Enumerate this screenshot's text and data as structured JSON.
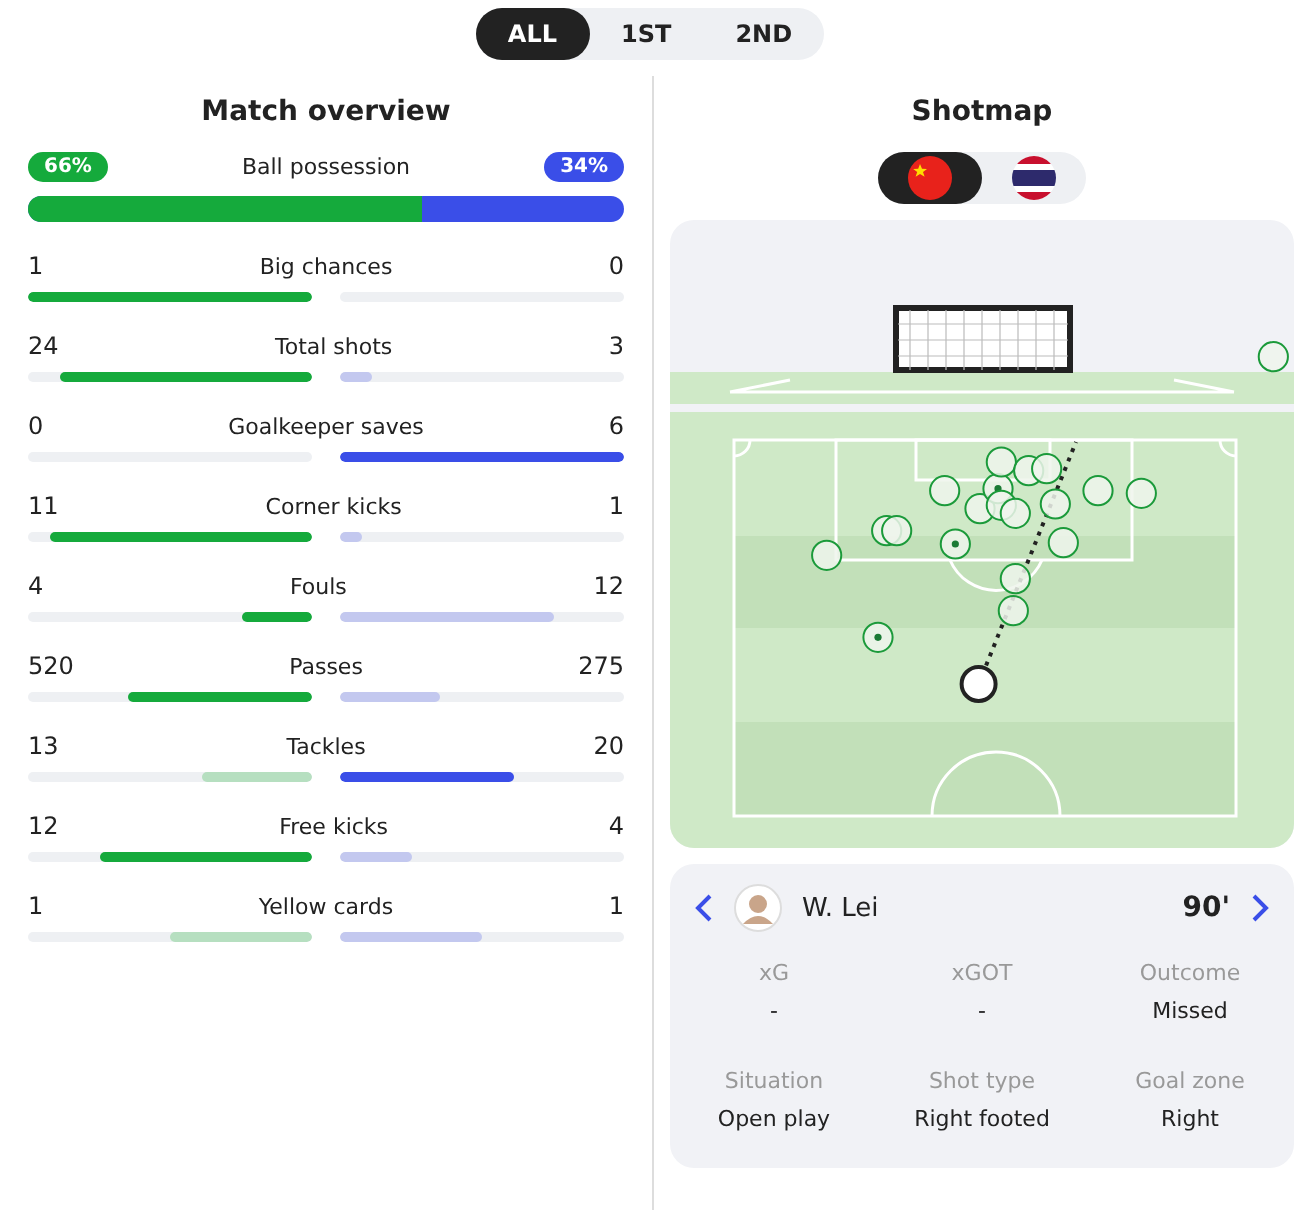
{
  "period_tabs": [
    {
      "label": "ALL",
      "selected": true
    },
    {
      "label": "1ST",
      "selected": false
    },
    {
      "label": "2ND",
      "selected": false
    }
  ],
  "overview": {
    "title": "Match overview",
    "possession": {
      "label": "Ball possession",
      "home": "66%",
      "away": "34%",
      "level": 0.66
    },
    "stats": [
      {
        "label": "Big chances",
        "home": {
          "value": "1",
          "level": 1,
          "leads": true
        },
        "away": {
          "value": "0",
          "level": 0
        }
      },
      {
        "label": "Total shots",
        "home": {
          "value": "24",
          "level": 0.89,
          "leads": true
        },
        "away": {
          "value": "3",
          "level": 0.11,
          "leads": false
        }
      },
      {
        "label": "Goalkeeper saves",
        "home": {
          "value": "0",
          "level": 0
        },
        "away": {
          "value": "6",
          "level": 1,
          "leads": true
        }
      },
      {
        "label": "Corner kicks",
        "home": {
          "value": "11",
          "level": 0.92,
          "leads": true
        },
        "away": {
          "value": "1",
          "level": 0.08,
          "leads": false
        }
      },
      {
        "label": "Fouls",
        "home": {
          "value": "4",
          "level": 0.25,
          "leads": true
        },
        "away": {
          "value": "12",
          "level": 0.75,
          "leads": false
        }
      },
      {
        "label": "Passes",
        "home": {
          "value": "520",
          "level": 0.65,
          "leads": true
        },
        "away": {
          "value": "275",
          "level": 0.35,
          "leads": false
        }
      },
      {
        "label": "Tackles",
        "home": {
          "value": "13",
          "level": 0.39,
          "leads": false
        },
        "away": {
          "value": "20",
          "level": 0.61,
          "leads": true
        }
      },
      {
        "label": "Free kicks",
        "home": {
          "value": "12",
          "level": 0.75,
          "leads": true
        },
        "away": {
          "value": "4",
          "level": 0.25,
          "leads": false
        }
      },
      {
        "label": "Yellow cards",
        "home": {
          "value": "1",
          "level": 0.5,
          "leads": false
        },
        "away": {
          "value": "1",
          "level": 0.5,
          "leads": false
        }
      }
    ]
  },
  "shotmap": {
    "title": "Shotmap",
    "teams": [
      {
        "kind": "china",
        "selected": true
      },
      {
        "kind": "thailand",
        "selected": false
      }
    ],
    "shot": {
      "player": "W. Lei",
      "minute": "90'",
      "details": [
        {
          "label": "xG",
          "value": "-"
        },
        {
          "label": "xGOT",
          "value": "-"
        },
        {
          "label": "Outcome",
          "value": "Missed"
        },
        {
          "label": "Situation",
          "value": "Open play"
        },
        {
          "label": "Shot type",
          "value": "Right footed"
        },
        {
          "label": "Goal zone",
          "value": "Right"
        }
      ]
    }
  }
}
